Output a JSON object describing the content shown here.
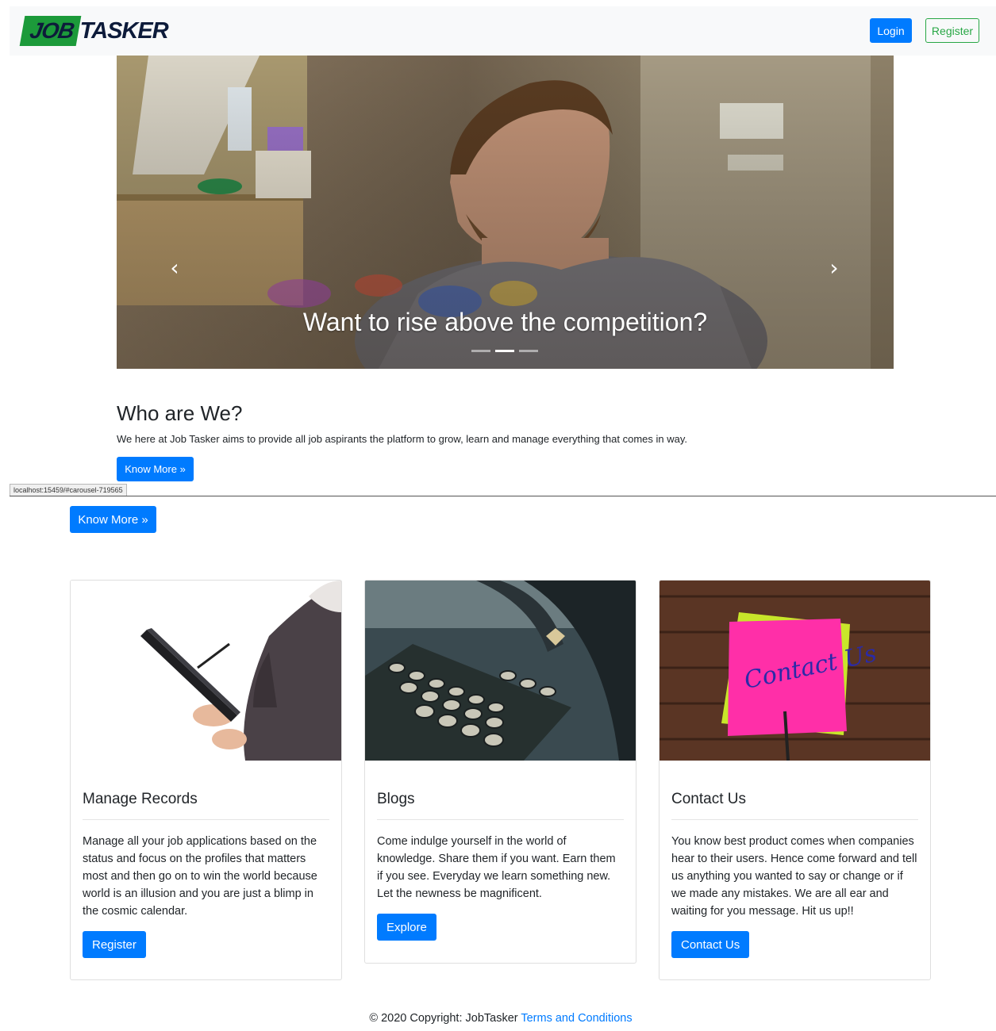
{
  "navbar": {
    "logo_part1": "JOB",
    "logo_part2": "TASKER",
    "login_label": "Login",
    "register_label": "Register"
  },
  "carousel": {
    "caption": "Want to rise above the competition?",
    "prev_icon": "chevron-left-icon",
    "next_icon": "chevron-right-icon",
    "prev_glyph": "‹",
    "next_glyph": "›",
    "slide_count": 3,
    "active_slide": 2
  },
  "who": {
    "title": "Who are We?",
    "text": "We here at Job Tasker aims to provide all job aspirants the platform to grow, learn and manage everything that comes in way.",
    "button_label": "Know More »"
  },
  "status_bar": {
    "url": "localhost:15459/#carousel-719565"
  },
  "second_button_label": "Know More »",
  "cards": [
    {
      "title": "Manage Records",
      "text": "Manage all your job applications based on the status and focus on the profiles that matters most and then go on to win the world because world is an illusion and you are just a blimp in the cosmic calendar.",
      "button_label": "Register"
    },
    {
      "title": "Blogs",
      "text": "Come indulge yourself in the world of knowledge. Share them if you want. Earn them if you see. Everyday we learn something new. Let the newness be magnificent.",
      "button_label": "Explore"
    },
    {
      "title": "Contact Us",
      "text": "You know best product comes when companies hear to their users. Hence come forward and tell us anything you wanted to say or change or if we made any mistakes. We are all ear and waiting for you message. Hit us up!!",
      "button_label": "Contact Us",
      "sticky_note_text": "Contact Us"
    }
  ],
  "footer": {
    "copyright": "© 2020 Copyright: JobTasker",
    "link_label": "Terms and Conditions"
  },
  "colors": {
    "primary": "#007bff",
    "success": "#28a745",
    "navbar_bg": "#f8f9fa",
    "logo_green": "#1c9a3a",
    "logo_navy": "#0d1b3a",
    "sticky_pink": "#ff2fa8"
  }
}
